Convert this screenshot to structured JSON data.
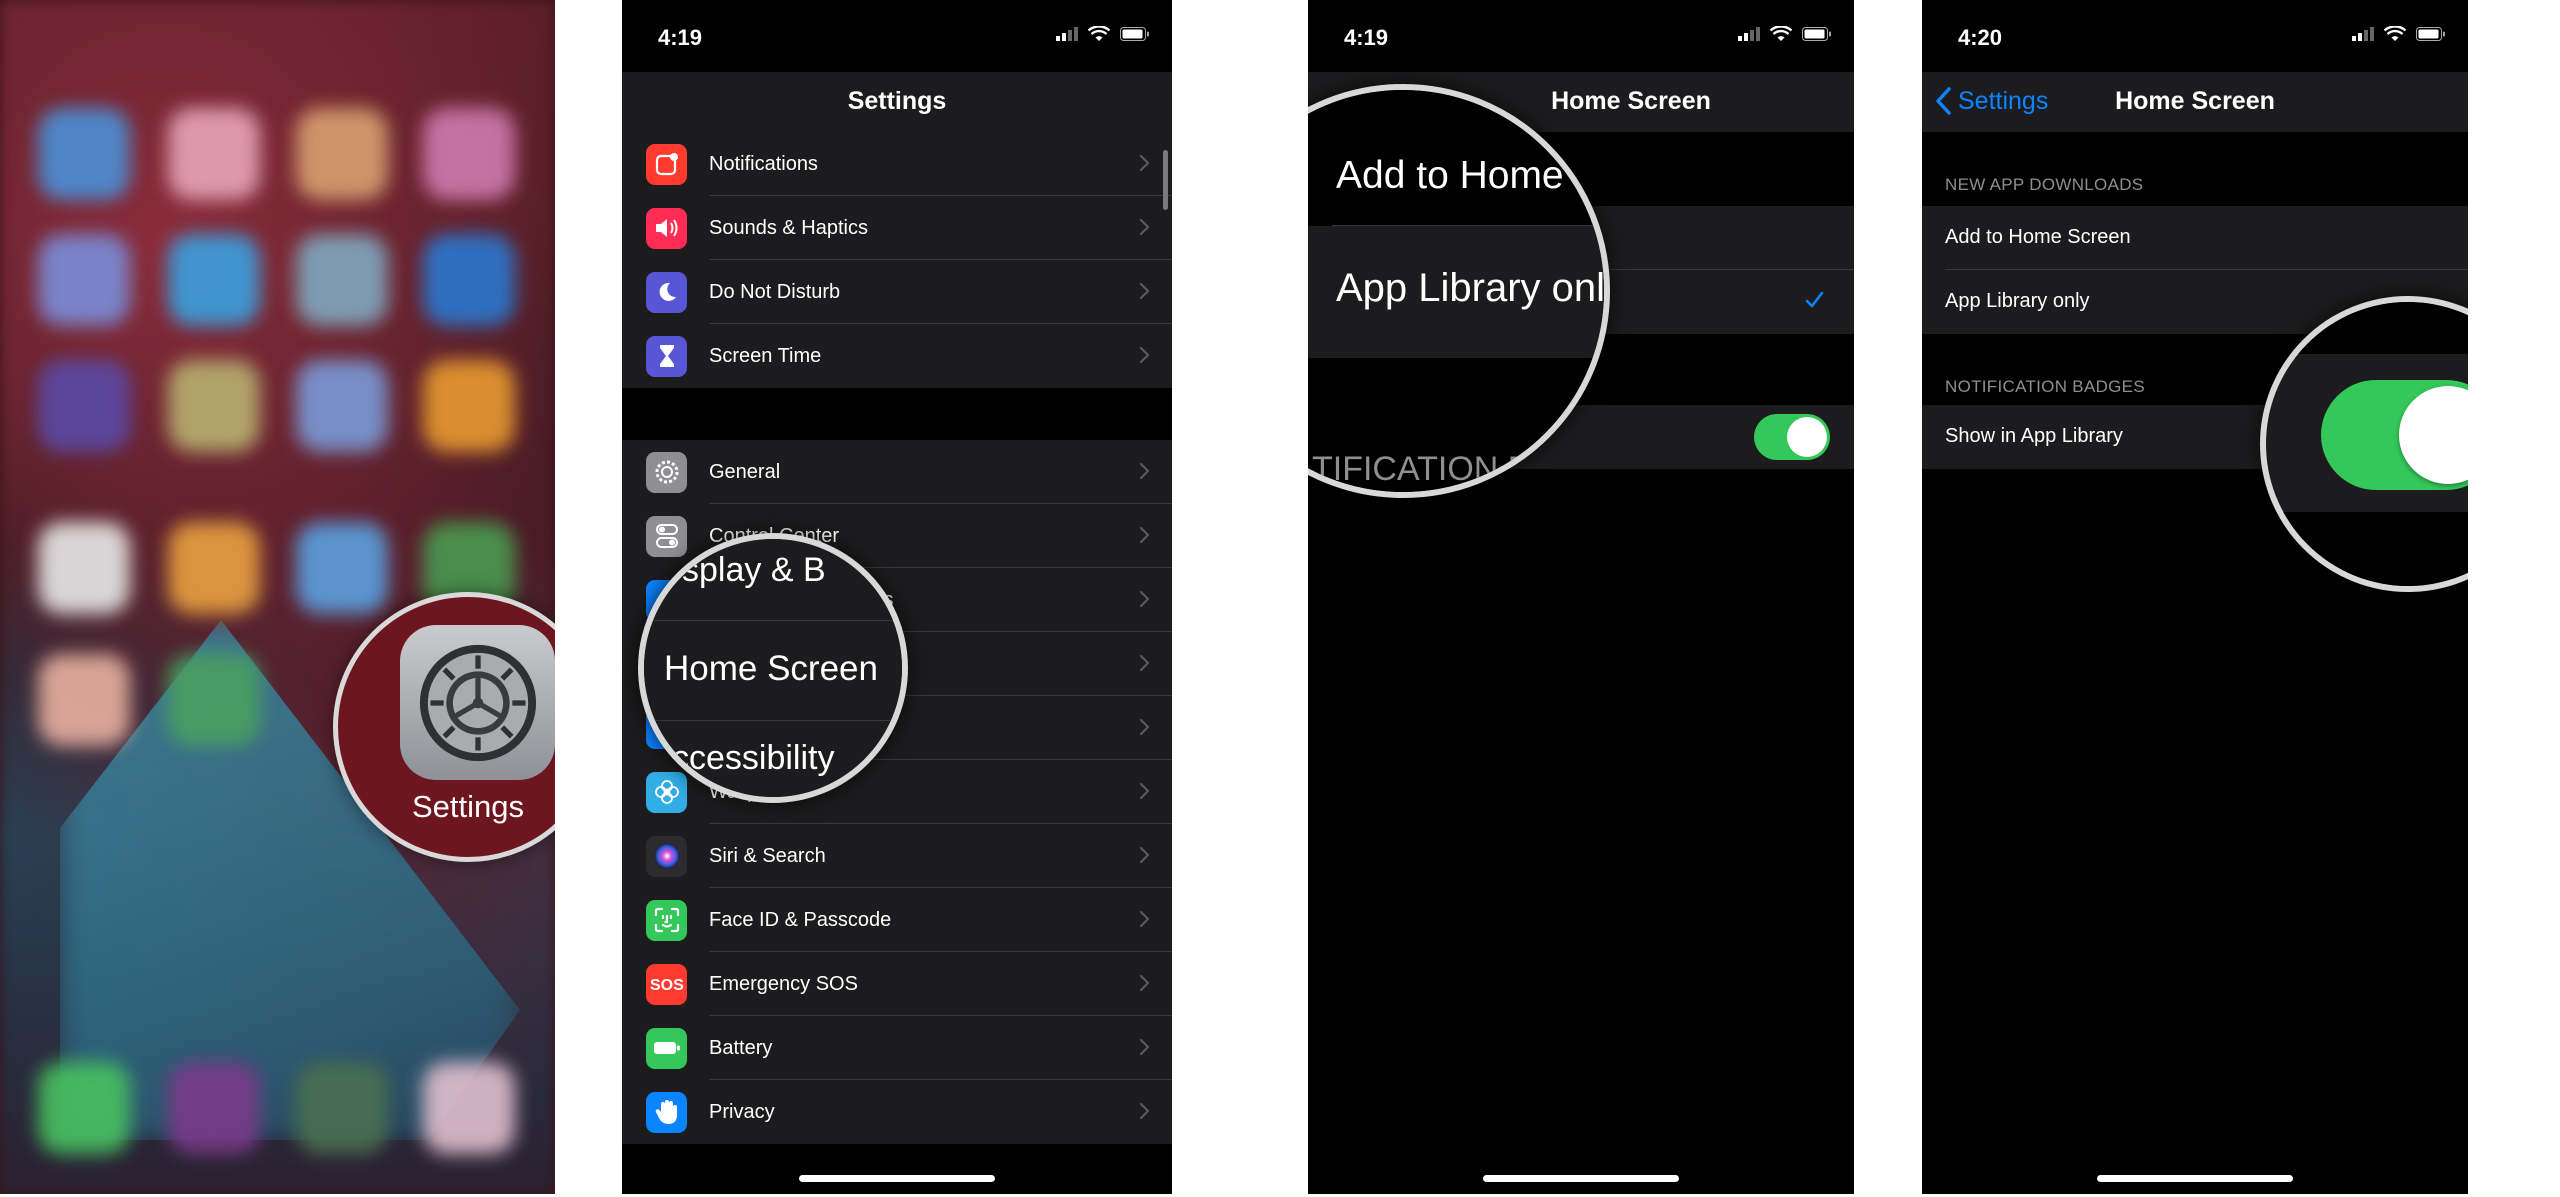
{
  "panel1": {
    "settings_label": "Settings",
    "icon_colors": [
      "#4a90d9",
      "#e8a4b8",
      "#d8a070",
      "#d07ab0",
      "#7a8cd8",
      "#3aa0e0",
      "#7fa8c0",
      "#2a78d0",
      "#5a4aa8",
      "#b8b070",
      "#7a9ad8",
      "#e89a30",
      "#e8e8e8",
      "#e8a040",
      "#5aa0e0",
      "#4a9a50",
      "#e8b0a0",
      "#4aa060",
      "#7a3a8a",
      "#5a5a5a",
      "#e0c0d0"
    ],
    "dock_colors": [
      "#48c060",
      "#7a3a8a",
      "#4a7050",
      "#e0c0d0"
    ]
  },
  "panel2": {
    "time": "4:19",
    "title": "Settings",
    "group1": [
      {
        "label": "Notifications",
        "icon": "notifications-icon",
        "color": "#ff3b30"
      },
      {
        "label": "Sounds & Haptics",
        "icon": "sounds-icon",
        "color": "#ff2d55"
      },
      {
        "label": "Do Not Disturb",
        "icon": "moon-icon",
        "color": "#5856d6"
      },
      {
        "label": "Screen Time",
        "icon": "hourglass-icon",
        "color": "#5856d6"
      }
    ],
    "group2": [
      {
        "label": "General",
        "icon": "gear-icon",
        "color": "#8e8e93"
      },
      {
        "label": "Control Center",
        "icon": "toggles-icon",
        "color": "#8e8e93"
      },
      {
        "label": "Display & Brightness",
        "icon": "display-icon",
        "color": "#0a84ff"
      },
      {
        "label": "Home Screen",
        "icon": "home-screen-icon",
        "color": "#0a84ff"
      },
      {
        "label": "Accessibility",
        "icon": "accessibility-icon",
        "color": "#0a84ff"
      },
      {
        "label": "Wallpaper",
        "icon": "wallpaper-icon",
        "color": "#32ade6"
      },
      {
        "label": "Siri & Search",
        "icon": "siri-icon",
        "color": "#2c2c2e"
      },
      {
        "label": "Face ID & Passcode",
        "icon": "face-id-icon",
        "color": "#34c759"
      },
      {
        "label": "Emergency SOS",
        "icon": "sos-icon",
        "color": "#ff3b30"
      },
      {
        "label": "Battery",
        "icon": "battery-icon",
        "color": "#34c759"
      },
      {
        "label": "Privacy",
        "icon": "hand-icon",
        "color": "#0a84ff"
      }
    ],
    "magnifier": {
      "top_text": "splay & B",
      "middle_text": "Home Screen",
      "bottom_text": "ccessibility"
    }
  },
  "panel3": {
    "time": "4:19",
    "title": "Home Screen",
    "row1": "Add to Home Screen",
    "row2": "App Library only",
    "magnifier": {
      "row1": "Add to Home Scr",
      "row2": "App Library only",
      "header": "TIFICATION B"
    }
  },
  "panel4": {
    "time": "4:20",
    "back_label": "Settings",
    "title": "Home Screen",
    "header1": "NEW APP DOWNLOADS",
    "row1": "Add to Home Screen",
    "row2": "App Library only",
    "header2": "NOTIFICATION BADGES",
    "row3": "Show in App Library"
  },
  "colors": {
    "accent": "#0a84ff",
    "toggle_on": "#34c759",
    "row_bg": "#1c1c1e",
    "bg": "#000000"
  }
}
